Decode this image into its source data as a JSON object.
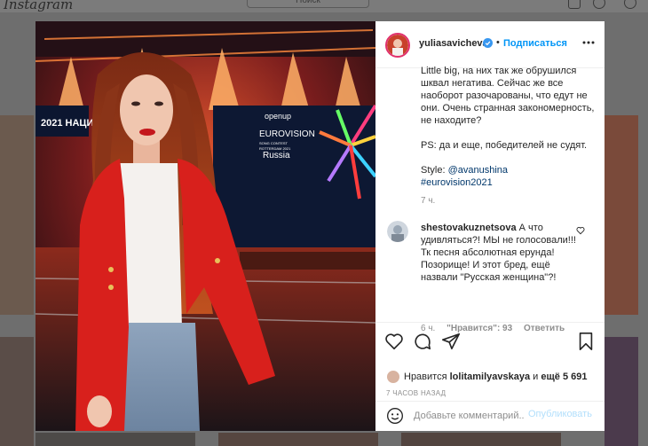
{
  "background": {
    "logo": "Instagram",
    "search_placeholder": "Поиск"
  },
  "post": {
    "image_alt": "Woman in red blazer on Eurovision stage",
    "stage_text": {
      "year_label": "2021 НАЦИ",
      "brand": "openup",
      "logo": "EUROVISION",
      "logo_sub": "SONG CONTEST",
      "logo_sub2": "ROTTERDAM 2021",
      "country": "Russia"
    }
  },
  "panel": {
    "username": "yuliasavicheva",
    "follow_label": "Подписаться",
    "caption_lines": [
      "Little big, на них так же обрушился шквал негатива. Сейчас же все наоборот разочарованы, что едут не они. Очень странная закономерность, не находите?",
      "PS: да и еще, победителей не судят."
    ],
    "style_prefix": "Style: ",
    "style_mention": "@avanushina",
    "hashtag": "#eurovision2021",
    "caption_time": "7 ч.",
    "comment": {
      "username": "shestovakuznetsova",
      "text": " А что удивляться?! МЫ не голосовали!!! Тк песня абсолютная ерунда! Позорище! И этот бред, ещё назвали \"Русская женщина\"?!",
      "time": "6 ч.",
      "likes": "\"Нравится\": 93",
      "reply_label": "Ответить"
    },
    "likes": {
      "prefix": "Нравится ",
      "user": "lolitamilyavskaya",
      "middle": " и ",
      "count": "ещё 5 691"
    },
    "posted_time": "7 ЧАСОВ НАЗАД",
    "add_comment_placeholder": "Добавьте комментарий...",
    "publish_label": "Опубликовать"
  },
  "colors": {
    "accent": "#0095f6",
    "link": "#00376b",
    "muted": "#8e8e8e",
    "blazer_red": "#d8201c"
  }
}
